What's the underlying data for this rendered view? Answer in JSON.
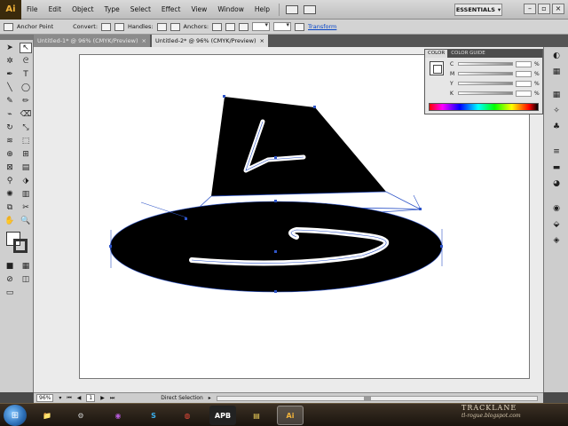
{
  "app": {
    "logo": "Ai",
    "workspace": "ESSENTIALS"
  },
  "menu": [
    "File",
    "Edit",
    "Object",
    "Type",
    "Select",
    "Effect",
    "View",
    "Window",
    "Help"
  ],
  "control_bar": {
    "anchor_point": "Anchor Point",
    "convert": "Convert:",
    "handles": "Handles:",
    "anchors": "Anchors:",
    "transform": "Transform"
  },
  "tabs": [
    {
      "label": "Untitled-1* @ 96% (CMYK/Preview)",
      "active": false
    },
    {
      "label": "Untitled-2* @ 96% (CMYK/Preview)",
      "active": true
    }
  ],
  "color_panel": {
    "tabs": [
      "COLOR",
      "COLOR GUIDE"
    ],
    "channels": [
      {
        "label": "C",
        "unit": "%"
      },
      {
        "label": "M",
        "unit": "%"
      },
      {
        "label": "Y",
        "unit": "%"
      },
      {
        "label": "K",
        "unit": "%"
      }
    ]
  },
  "status_bar": {
    "zoom": "96%",
    "page": "1",
    "tool": "Direct Selection"
  },
  "taskbar": {
    "apps": [
      "Explorer",
      "Steam",
      "Media",
      "Skype",
      "Chrome",
      "APB",
      "Folder",
      "Ai"
    ],
    "active_app": "Ai"
  },
  "watermark": {
    "title": "TRACKLANE",
    "url": "tl-rogue.blogspot.com"
  },
  "colors": {
    "ai_orange": "#f0b23a",
    "ai_bg": "#3a2a0c",
    "transform_link": "#0645c8",
    "path_blue": "#2f55c8"
  }
}
